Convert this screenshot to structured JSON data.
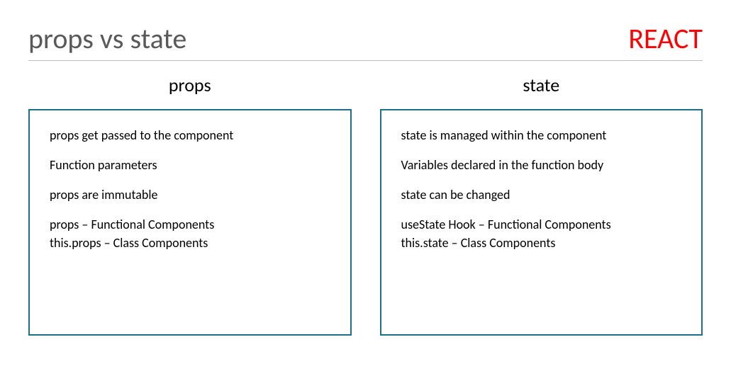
{
  "header": {
    "title": "props vs state",
    "brand": "REACT"
  },
  "left": {
    "heading": "props",
    "items": [
      "props get passed to the component",
      "Function parameters",
      "props are immutable"
    ],
    "group": [
      "props – Functional Components",
      "this.props – Class Components"
    ]
  },
  "right": {
    "heading": "state",
    "items": [
      "state is managed within the component",
      "Variables declared in the function body",
      "state can be changed"
    ],
    "group": [
      "useState Hook – Functional Components",
      "this.state – Class Components"
    ]
  }
}
